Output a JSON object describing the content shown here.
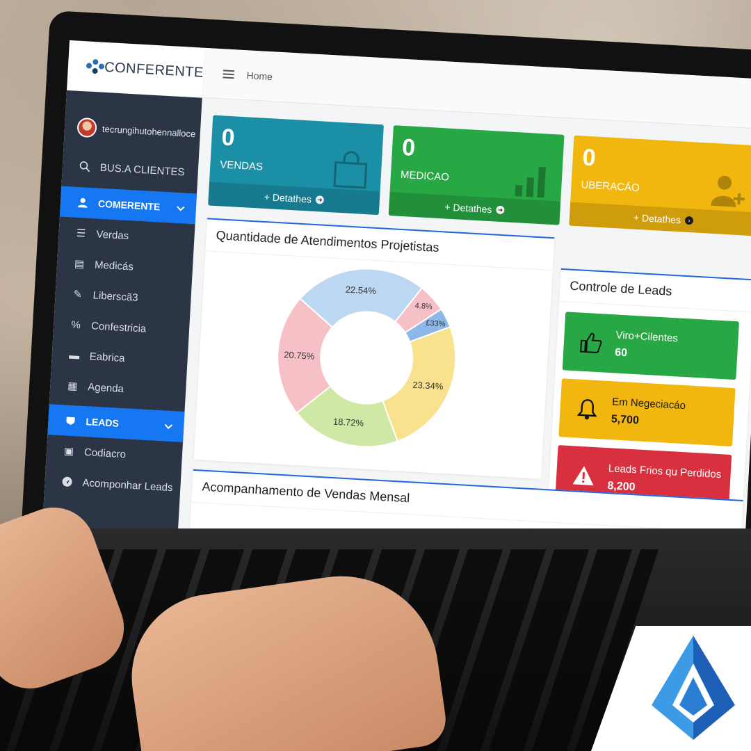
{
  "brand": {
    "name": "CONFERENTE"
  },
  "user": {
    "name": "tecrungihutohennalloce"
  },
  "sidebar": {
    "search_label": "BUS.A CLIENTES",
    "section1": "COMERENTE",
    "items1": [
      {
        "label": "Verdas",
        "icon": "list-icon"
      },
      {
        "label": "Medicás",
        "icon": "chart-icon"
      },
      {
        "label": "Liberscã3",
        "icon": "tools-icon"
      },
      {
        "label": "Confestricia",
        "icon": "percent-icon"
      },
      {
        "label": "Eabrica",
        "icon": "list-icon"
      },
      {
        "label": "Agenda",
        "icon": "calendar-icon"
      }
    ],
    "section2": "LEADS",
    "items2": [
      {
        "label": "Codiacro",
        "icon": "building-icon"
      },
      {
        "label": "Acomponhar Leads",
        "icon": "navigation-icon"
      }
    ]
  },
  "topbar": {
    "breadcrumb": "Home"
  },
  "stats": [
    {
      "value": "0",
      "label": "VENDAS",
      "footer": "+ Detathes",
      "color": "#1b8fa6",
      "icon": "shopping-bag-icon"
    },
    {
      "value": "0",
      "label": "MEDICAO",
      "footer": "+ Detathes",
      "color": "#28a745",
      "icon": "bar-chart-icon"
    },
    {
      "value": "0",
      "label": "UBERACÁO",
      "footer": "+ Detathes",
      "color": "#f1b70e",
      "icon": "user-plus-icon"
    }
  ],
  "donut_panel": {
    "title": "Quantidade de Atendimentos Projetistas"
  },
  "chart_data": {
    "type": "pie",
    "donut": true,
    "labels": [
      "22.54%",
      "4.8%",
      "£33%",
      "23.34%",
      "18.72%",
      "20.75%"
    ],
    "values": [
      22.54,
      4.8,
      3.33,
      23.34,
      18.72,
      20.75
    ],
    "colors": [
      "#bcd7f2",
      "#f6c1c6",
      "#8cb7e6",
      "#f9e28e",
      "#cfe8a6",
      "#f6c1c6"
    ]
  },
  "leads_panel": {
    "title": "Controle de Leads",
    "cards": [
      {
        "label": "Viro+Cilentes",
        "value": "60",
        "color": "#28a745",
        "icon": "thumbs-up-icon"
      },
      {
        "label": "Em Negeciacáo",
        "value": "5,700",
        "color": "#f1b70e",
        "icon": "bell-icon"
      },
      {
        "label": "Leads Frios qu Perdidos",
        "value": "8,200",
        "color": "#d9303f",
        "icon": "warning-icon"
      }
    ]
  },
  "sales_panel": {
    "title": "Acompanhamento de Vendas Mensal"
  }
}
